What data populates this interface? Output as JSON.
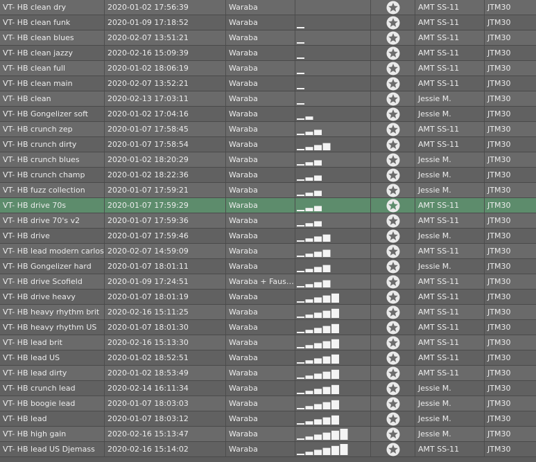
{
  "colors": {
    "row_odd": "#6a6a6a",
    "row_even": "#616161",
    "row_selected": "#5d8c6c",
    "text": "#ececec",
    "star_badge": "#eaeaea"
  },
  "icons": {
    "favorite": "star-badge-icon",
    "rating": "signal-bars-icon"
  },
  "rows": [
    {
      "name": "VT- HB clean dry",
      "date": "2020-01-02 17:56:39",
      "author": "Waraba",
      "rating": 0,
      "amp": "AMT SS-11",
      "cab": "JTM30"
    },
    {
      "name": "VT- HB clean funk",
      "date": "2020-01-09 17:18:52",
      "author": "Waraba",
      "rating": 1,
      "amp": "AMT SS-11",
      "cab": "JTM30"
    },
    {
      "name": "VT- HB clean blues",
      "date": "2020-02-07 13:51:21",
      "author": "Waraba",
      "rating": 1,
      "amp": "AMT SS-11",
      "cab": "JTM30"
    },
    {
      "name": "VT- HB clean jazzy",
      "date": "2020-02-16 15:09:39",
      "author": "Waraba",
      "rating": 1,
      "amp": "AMT SS-11",
      "cab": "JTM30"
    },
    {
      "name": "VT- HB clean full",
      "date": "2020-01-02 18:06:19",
      "author": "Waraba",
      "rating": 1,
      "amp": "AMT SS-11",
      "cab": "JTM30"
    },
    {
      "name": "VT- HB clean main",
      "date": "2020-02-07 13:52:21",
      "author": "Waraba",
      "rating": 1,
      "amp": "AMT SS-11",
      "cab": "JTM30"
    },
    {
      "name": "VT- HB clean",
      "date": "2020-02-13 17:03:11",
      "author": "Waraba",
      "rating": 1,
      "amp": "Jessie M.",
      "cab": "JTM30"
    },
    {
      "name": "VT- HB Gongelizer soft",
      "date": "2020-01-02 17:04:16",
      "author": "Waraba",
      "rating": 2,
      "amp": "Jessie M.",
      "cab": "JTM30"
    },
    {
      "name": "VT- HB crunch zep",
      "date": "2020-01-07 17:58:45",
      "author": "Waraba",
      "rating": 3,
      "amp": "AMT SS-11",
      "cab": "JTM30"
    },
    {
      "name": "VT- HB crunch dirty",
      "date": "2020-01-07 17:58:54",
      "author": "Waraba",
      "rating": 4,
      "amp": "AMT SS-11",
      "cab": "JTM30"
    },
    {
      "name": "VT- HB crunch blues",
      "date": "2020-01-02 18:20:29",
      "author": "Waraba",
      "rating": 3,
      "amp": "Jessie M.",
      "cab": "JTM30"
    },
    {
      "name": "VT- HB crunch champ",
      "date": "2020-01-02 18:22:36",
      "author": "Waraba",
      "rating": 3,
      "amp": "Jessie M.",
      "cab": "JTM30"
    },
    {
      "name": "VT- HB fuzz collection",
      "date": "2020-01-07 17:59:21",
      "author": "Waraba",
      "rating": 3,
      "amp": "Jessie M.",
      "cab": "JTM30"
    },
    {
      "name": "VT- HB drive 70s",
      "date": "2020-01-07 17:59:29",
      "author": "Waraba",
      "rating": 3,
      "amp": "AMT SS-11",
      "cab": "JTM30",
      "selected": true
    },
    {
      "name": "VT- HB drive 70's v2",
      "date": "2020-01-07 17:59:36",
      "author": "Waraba",
      "rating": 3,
      "amp": "AMT SS-11",
      "cab": "JTM30"
    },
    {
      "name": "VT- HB drive",
      "date": "2020-01-07 17:59:46",
      "author": "Waraba",
      "rating": 4,
      "amp": "Jessie M.",
      "cab": "JTM30"
    },
    {
      "name": "VT- HB lead modern carlos",
      "date": "2020-02-07 14:59:09",
      "author": "Waraba",
      "rating": 4,
      "amp": "AMT SS-11",
      "cab": "JTM30"
    },
    {
      "name": "VT- HB Gongelizer hard",
      "date": "2020-01-07 18:01:11",
      "author": "Waraba",
      "rating": 4,
      "amp": "Jessie M.",
      "cab": "JTM30"
    },
    {
      "name": "VT- HB drive Scofield",
      "date": "2020-01-09 17:24:51",
      "author": "Waraba + Faust…",
      "rating": 4,
      "amp": "AMT SS-11",
      "cab": "JTM30"
    },
    {
      "name": "VT- HB drive heavy",
      "date": "2020-01-07 18:01:19",
      "author": "Waraba",
      "rating": 5,
      "amp": "AMT SS-11",
      "cab": "JTM30"
    },
    {
      "name": "VT- HB heavy rhythm brit",
      "date": "2020-02-16 15:11:25",
      "author": "Waraba",
      "rating": 5,
      "amp": "AMT SS-11",
      "cab": "JTM30"
    },
    {
      "name": "VT- HB heavy rhythm US",
      "date": "2020-01-07 18:01:30",
      "author": "Waraba",
      "rating": 5,
      "amp": "AMT SS-11",
      "cab": "JTM30"
    },
    {
      "name": "VT- HB lead brit",
      "date": "2020-02-16 15:13:30",
      "author": "Waraba",
      "rating": 5,
      "amp": "AMT SS-11",
      "cab": "JTM30"
    },
    {
      "name": "VT- HB lead US",
      "date": "2020-01-02 18:52:51",
      "author": "Waraba",
      "rating": 5,
      "amp": "AMT SS-11",
      "cab": "JTM30"
    },
    {
      "name": "VT- HB lead dirty",
      "date": "2020-01-02 18:53:49",
      "author": "Waraba",
      "rating": 5,
      "amp": "AMT SS-11",
      "cab": "JTM30"
    },
    {
      "name": "VT- HB crunch lead",
      "date": "2020-02-14 16:11:34",
      "author": "Waraba",
      "rating": 5,
      "amp": "Jessie M.",
      "cab": "JTM30"
    },
    {
      "name": "VT- HB boogie lead",
      "date": "2020-01-07 18:03:03",
      "author": "Waraba",
      "rating": 5,
      "amp": "Jessie M.",
      "cab": "JTM30"
    },
    {
      "name": "VT- HB lead",
      "date": "2020-01-07 18:03:12",
      "author": "Waraba",
      "rating": 5,
      "amp": "Jessie M.",
      "cab": "JTM30"
    },
    {
      "name": "VT- HB high gain",
      "date": "2020-02-16 15:13:47",
      "author": "Waraba",
      "rating": 6,
      "amp": "Jessie M.",
      "cab": "JTM30"
    },
    {
      "name": "VT- HB lead US Djemass",
      "date": "2020-02-16 15:14:02",
      "author": "Waraba",
      "rating": 6,
      "amp": "AMT SS-11",
      "cab": "JTM30"
    }
  ]
}
